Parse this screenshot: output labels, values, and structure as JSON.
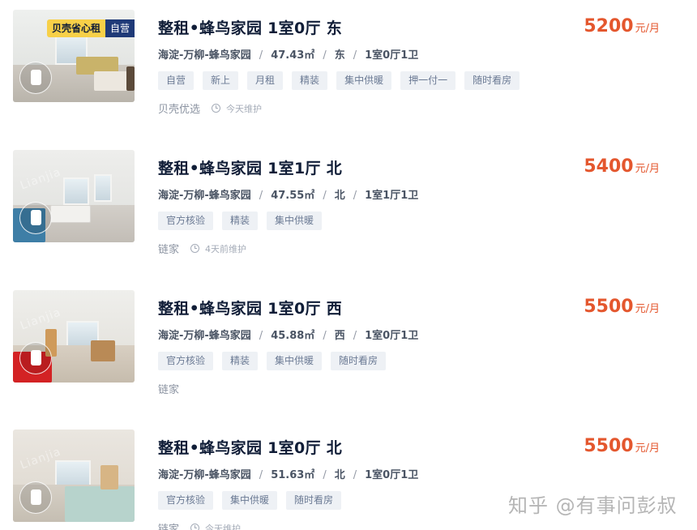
{
  "listings": [
    {
      "title": "整租•蜂鸟家园 1室0厅 东",
      "price": "5200",
      "price_unit": "元/月",
      "location": "海淀-万柳-蜂鸟家园",
      "sep": "/",
      "area": "47.43㎡",
      "orientation": "东",
      "layout": "1室0厅1卫",
      "tags": [
        "自营",
        "新上",
        "月租",
        "精装",
        "集中供暖",
        "押一付一",
        "随时看房"
      ],
      "brand": "贝壳优选",
      "maintenance": "今天维护",
      "badge_main": "贝壳省心租",
      "badge_self": "自营",
      "icon": "clock-icon"
    },
    {
      "title": "整租•蜂鸟家园 1室1厅 北",
      "price": "5400",
      "price_unit": "元/月",
      "location": "海淀-万柳-蜂鸟家园",
      "sep": "/",
      "area": "47.55㎡",
      "orientation": "北",
      "layout": "1室1厅1卫",
      "tags": [
        "官方核验",
        "精装",
        "集中供暖"
      ],
      "brand": "链家",
      "maintenance": "4天前维护",
      "watermark": "Lianjia",
      "icon": "clock-icon"
    },
    {
      "title": "整租•蜂鸟家园 1室0厅 西",
      "price": "5500",
      "price_unit": "元/月",
      "location": "海淀-万柳-蜂鸟家园",
      "sep": "/",
      "area": "45.88㎡",
      "orientation": "西",
      "layout": "1室0厅1卫",
      "tags": [
        "官方核验",
        "精装",
        "集中供暖",
        "随时看房"
      ],
      "brand": "链家",
      "watermark": "Lianjia"
    },
    {
      "title": "整租•蜂鸟家园 1室0厅 北",
      "price": "5500",
      "price_unit": "元/月",
      "location": "海淀-万柳-蜂鸟家园",
      "sep": "/",
      "area": "51.63㎡",
      "orientation": "北",
      "layout": "1室0厅1卫",
      "tags": [
        "官方核验",
        "集中供暖",
        "随时看房"
      ],
      "brand": "链家",
      "maintenance": "今天维护",
      "watermark": "Lianjia",
      "icon": "clock-icon"
    }
  ],
  "watermark_text": "知乎 @有事问彭叔",
  "colors": {
    "price": "#e4572e",
    "title": "#101d37",
    "tag_bg": "#eef1f5",
    "tag_text": "#6b7a94",
    "badge_yellow": "#f7d048",
    "badge_navy": "#1f3a78"
  }
}
